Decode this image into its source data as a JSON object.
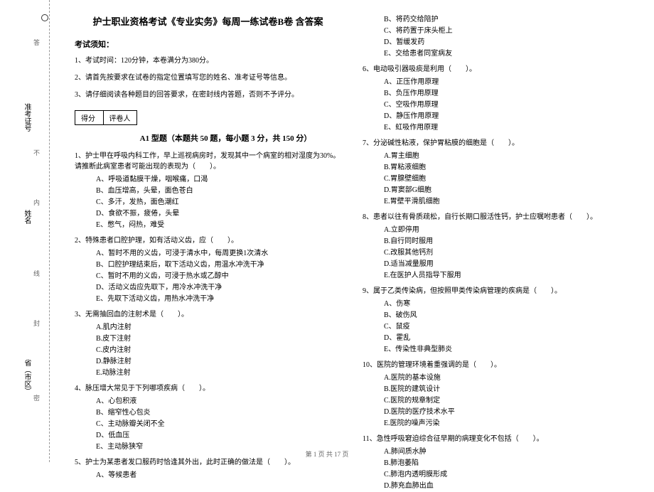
{
  "margin": {
    "labels": [
      "准考证号",
      "姓名",
      "省（市区）"
    ],
    "markers": [
      "答",
      "不",
      "内",
      "线",
      "封",
      "密"
    ],
    "circle": "圈"
  },
  "title": "护士职业资格考试《专业实务》每周一练试卷B卷 含答案",
  "notice_heading": "考试须知：",
  "instructions": [
    "1、考试时间：120分钟，本卷满分为380分。",
    "2、请首先按要求在试卷的指定位置填写您的姓名、准考证号等信息。",
    "3、请仔细阅读各种题目的回答要求，在密封线内答题，否则不予评分。"
  ],
  "score_box": {
    "score": "得分",
    "grader": "评卷人"
  },
  "section_title": "A1 型题（本题共 50 题，每小题 3 分，共 150 分）",
  "left_questions": [
    {
      "stem": "1、护士甲在呼吸内科工作，早上巡视病房时，发现其中一个病室的相对湿度为30%。请推断此病室患者可能出现的表现为（　　）。",
      "options": [
        "A、呼吸道黏膜干燥，咽喉痛，口渴",
        "B、血压增高，头晕，面色苍白",
        "C、多汗，发热，面色潮红",
        "D、食欲不振，疲倦，头晕",
        "E、憋气，闷热，难受"
      ]
    },
    {
      "stem": "2、特殊患者口腔护理，如有活动义齿，应（　　）。",
      "options": [
        "A、暂时不用的义齿，可浸于清水中，每周更换1次清水",
        "B、口腔护理结束后，取下活动义齿，用温水冲洗干净",
        "C、暂时不用的义齿，可浸于热水或乙醇中",
        "D、活动义齿应先取下，用冷水冲洗干净",
        "E、先取下活动义齿，用热水冲洗干净"
      ]
    },
    {
      "stem": "3、无需抽回血的注射术是（　　）。",
      "options": [
        "A.肌内注射",
        "B.皮下注射",
        "C.皮内注射",
        "D.静脉注射",
        "E.动脉注射"
      ]
    },
    {
      "stem": "4、脉压增大常见于下列哪项疾病（　　）。",
      "options": [
        "A、心包积液",
        "B、缩窄性心包炎",
        "C、主动脉瓣关闭不全",
        "D、低血压",
        "E、主动脉狭窄"
      ]
    },
    {
      "stem": "5、护士为某患者发口服药时恰逢其外出，此时正确的做法是（　　）。",
      "options": [
        "A、等候患者"
      ]
    }
  ],
  "right_questions": [
    {
      "stem": "",
      "options": [
        "B、将药交给陪护",
        "C、将药置于床头柜上",
        "D、暂缓发药",
        "E、交给患者同室病友"
      ]
    },
    {
      "stem": "6、电动吸引器吸痰是利用（　　）。",
      "options": [
        "A、正压作用原理",
        "B、负压作用原理",
        "C、空吸作用原理",
        "D、静压作用原理",
        "E、虹吸作用原理"
      ]
    },
    {
      "stem": "7、分泌碱性粘液，保护胃粘膜的细胞是（　　）。",
      "options": [
        "A.胃主细胞",
        "B.胃粘液细胞",
        "C.胃腺壁细胞",
        "D.胃窦部G细胞",
        "E.胃壁平滑肌细胞"
      ]
    },
    {
      "stem": "8、患者以往有骨质疏松，自行长期口服活性钙，护士应嘱咐患者（　　）。",
      "options": [
        "A.立即停用",
        "B.自行同时服用",
        "C.改服其他钙剂",
        "D.适当减量服用",
        "E.在医护人员指导下服用"
      ]
    },
    {
      "stem": "9、属于乙类传染病，但按照甲类传染病管理的疾病是（　　）。",
      "options": [
        "A、伤寒",
        "B、破伤风",
        "C、鼠疫",
        "D、霍乱",
        "E、传染性非典型肺炎"
      ]
    },
    {
      "stem": "10、医院的管理环境着重强调的是（　　）。",
      "options": [
        "A.医院的基本设施",
        "B.医院的建筑设计",
        "C.医院的规章制定",
        "D.医院的医疗技术水平",
        "E.医院的噪声污染"
      ]
    },
    {
      "stem": "11、急性呼吸窘迫综合征早期的病理变化不包括（　　）。",
      "options": [
        "A.肺间质水肿",
        "B.肺泡萎陷",
        "C.肺泡内透明膜形成",
        "D.肺充血肺出血"
      ]
    }
  ],
  "footer": "第 1 页 共 17 页"
}
